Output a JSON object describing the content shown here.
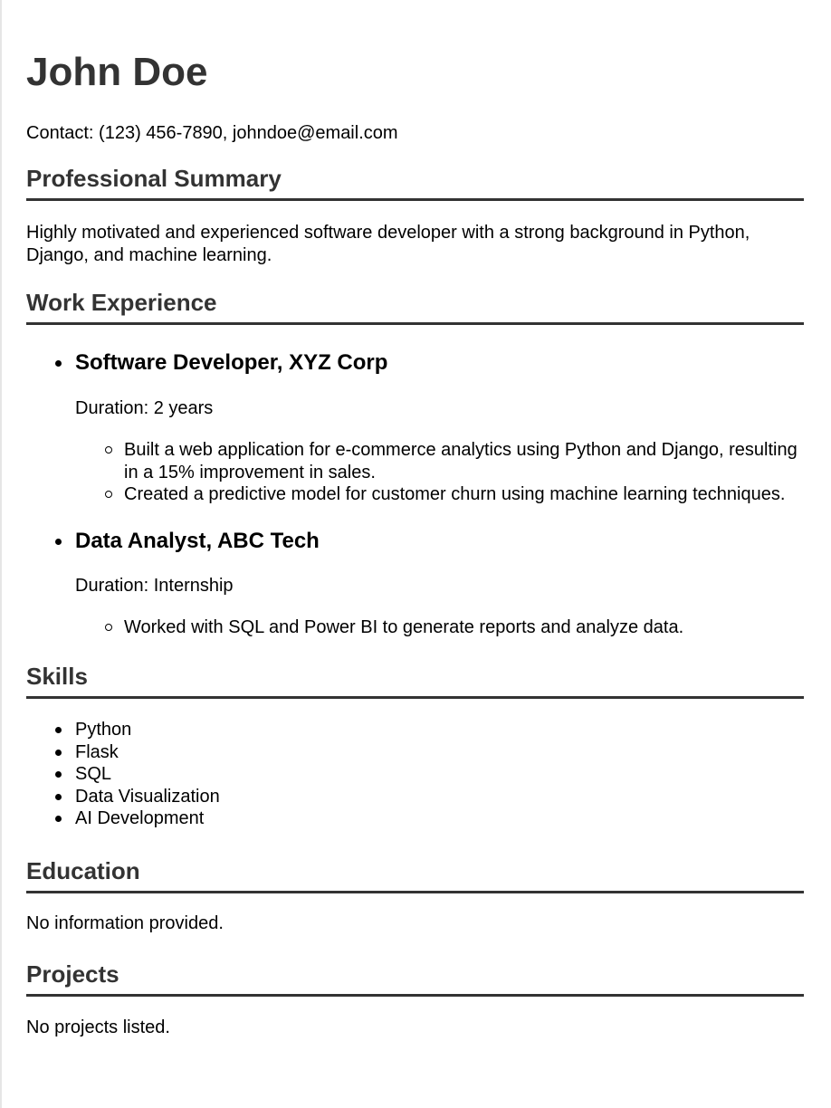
{
  "name": "John Doe",
  "contact": "Contact: (123) 456-7890, johndoe@email.com",
  "summary": {
    "title": "Professional Summary",
    "text": "Highly motivated and experienced software developer with a strong background in Python, Django, and machine learning."
  },
  "experience": {
    "title": "Work Experience",
    "jobs": [
      {
        "title": "Software Developer, XYZ Corp",
        "duration": "Duration: 2 years",
        "tasks": [
          "Built a web application for e-commerce analytics using Python and Django, resulting in a 15% improvement in sales.",
          "Created a predictive model for customer churn using machine learning techniques."
        ]
      },
      {
        "title": "Data Analyst, ABC Tech",
        "duration": "Duration: Internship",
        "tasks": [
          "Worked with SQL and Power BI to generate reports and analyze data."
        ]
      }
    ]
  },
  "skills": {
    "title": "Skills",
    "items": [
      "Python",
      "Flask",
      "SQL",
      "Data Visualization",
      "AI Development"
    ]
  },
  "education": {
    "title": "Education",
    "text": "No information provided."
  },
  "projects": {
    "title": "Projects",
    "text": "No projects listed."
  }
}
